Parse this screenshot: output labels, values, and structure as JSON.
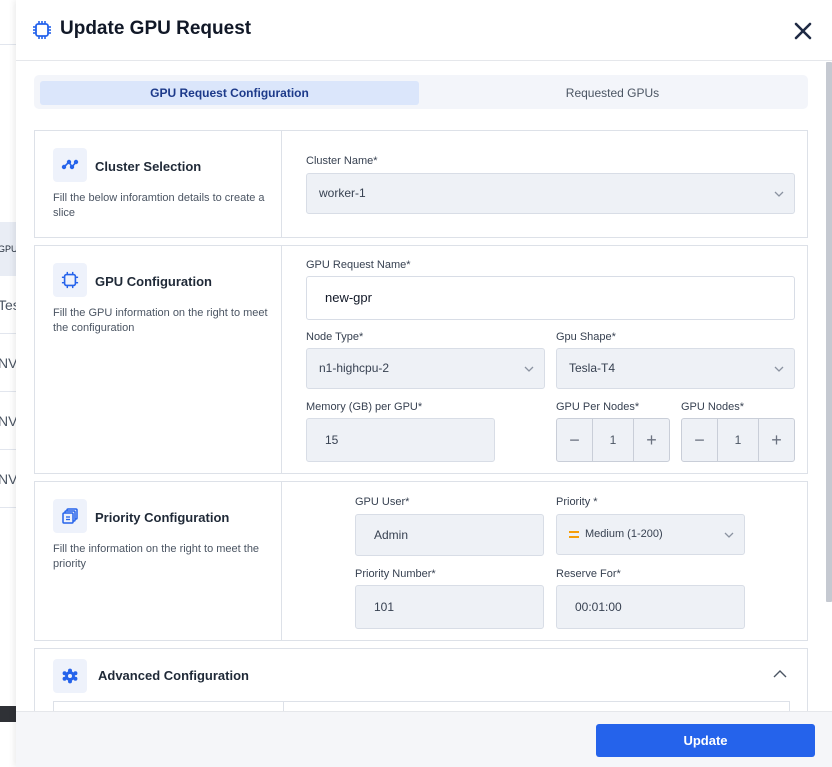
{
  "header": {
    "title": "Update GPU Request",
    "icon": "chip-icon",
    "close_icon": "close-icon"
  },
  "tabs": [
    {
      "label": "GPU Request Configuration",
      "active": true
    },
    {
      "label": "Requested GPUs",
      "active": false
    }
  ],
  "cluster_section": {
    "title": "Cluster Selection",
    "description": "Fill the below inforamtion details to create a slice",
    "cluster_name_label": "Cluster Name*",
    "cluster_name_value": "worker-1"
  },
  "gpu_section": {
    "title": "GPU Configuration",
    "description": "Fill the GPU information on the right to meet the configuration",
    "request_name_label": "GPU Request Name*",
    "request_name_value": "new-gpr",
    "node_type_label": "Node Type*",
    "node_type_value": "n1-highcpu-2",
    "gpu_shape_label": "Gpu Shape*",
    "gpu_shape_value": "Tesla-T4",
    "memory_label": "Memory (GB) per GPU*",
    "memory_value": "15",
    "gpu_per_nodes_label": "GPU Per Nodes*",
    "gpu_per_nodes_value": "1",
    "gpu_nodes_label": "GPU Nodes*",
    "gpu_nodes_value": "1",
    "minus_symbol": "−",
    "plus_symbol": "+"
  },
  "priority_section": {
    "title": "Priority Configuration",
    "description": "Fill the information on the right to meet the priority",
    "gpu_user_label": "GPU User*",
    "gpu_user_value": "Admin",
    "priority_label": "Priority *",
    "priority_value": "Medium (1-200)",
    "priority_number_label": "Priority Number*",
    "priority_number_value": "101",
    "reserve_for_label": "Reserve For*",
    "reserve_for_value": "00:01:00"
  },
  "advanced_section": {
    "title": "Advanced Configuration",
    "expanded": true
  },
  "footer": {
    "update_label": "Update"
  },
  "background": {
    "row_texts": [
      "GPU",
      "Tes",
      "NV",
      "NV",
      "NV"
    ]
  },
  "colors": {
    "accent": "#2563eb",
    "priority_medium": "#f59e0b"
  }
}
